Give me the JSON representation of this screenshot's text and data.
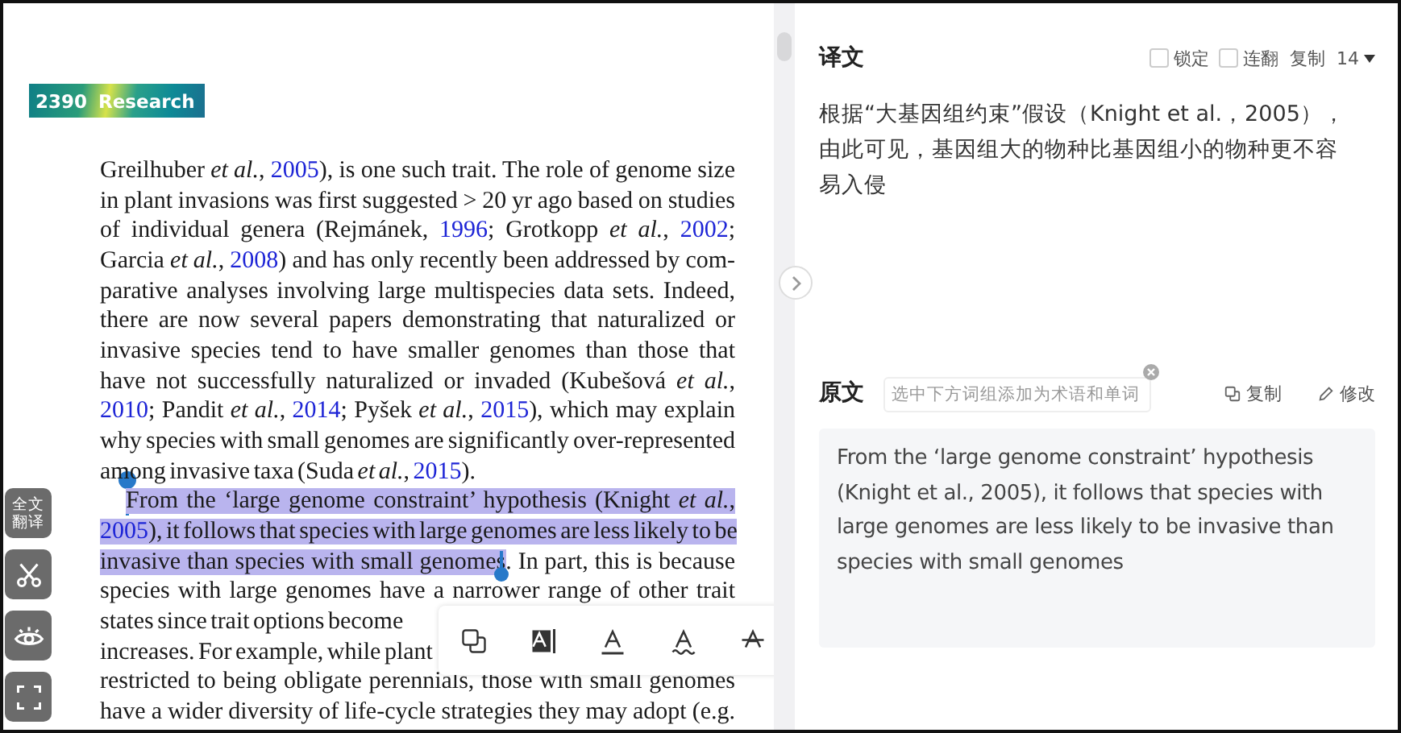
{
  "document": {
    "banner": {
      "number": "2390",
      "section": "Research"
    },
    "paragraphs": [
      {
        "indented": false,
        "lines": [
          {
            "justified": true,
            "segments": [
              {
                "kind": "text",
                "text": "Greilhuber ",
                "highlighted": false
              },
              {
                "kind": "italic",
                "text": "et al.",
                "highlighted": false
              },
              {
                "kind": "text",
                "text": ", ",
                "highlighted": false
              },
              {
                "kind": "link",
                "text": "2005",
                "highlighted": false
              },
              {
                "kind": "text",
                "text": "), is one such trait. The role of genome size",
                "highlighted": false
              }
            ]
          },
          {
            "justified": true,
            "segments": [
              {
                "kind": "text",
                "text": "in plant invasions was first suggested > 20 yr ago based on studies",
                "highlighted": false
              }
            ]
          },
          {
            "justified": true,
            "segments": [
              {
                "kind": "text",
                "text": "of individual genera (Rejmánek, ",
                "highlighted": false
              },
              {
                "kind": "link",
                "text": "1996",
                "highlighted": false
              },
              {
                "kind": "text",
                "text": "; Grotkopp ",
                "highlighted": false
              },
              {
                "kind": "italic",
                "text": "et al.",
                "highlighted": false
              },
              {
                "kind": "text",
                "text": ", ",
                "highlighted": false
              },
              {
                "kind": "link",
                "text": "2002",
                "highlighted": false
              },
              {
                "kind": "text",
                "text": ";",
                "highlighted": false
              }
            ]
          },
          {
            "justified": true,
            "segments": [
              {
                "kind": "text",
                "text": "Garcia ",
                "highlighted": false
              },
              {
                "kind": "italic",
                "text": "et al.",
                "highlighted": false
              },
              {
                "kind": "text",
                "text": ", ",
                "highlighted": false
              },
              {
                "kind": "link",
                "text": "2008",
                "highlighted": false
              },
              {
                "kind": "text",
                "text": ") and has only recently been addressed by com-",
                "highlighted": false
              }
            ]
          },
          {
            "justified": true,
            "segments": [
              {
                "kind": "text",
                "text": "parative analyses involving large multispecies data sets. Indeed,",
                "highlighted": false
              }
            ]
          },
          {
            "justified": true,
            "segments": [
              {
                "kind": "text",
                "text": "there are now several papers demonstrating that naturalized or",
                "highlighted": false
              }
            ]
          },
          {
            "justified": true,
            "segments": [
              {
                "kind": "text",
                "text": "invasive species tend to have smaller genomes than those that",
                "highlighted": false
              }
            ]
          },
          {
            "justified": true,
            "segments": [
              {
                "kind": "text",
                "text": "have not successfully naturalized or invaded (Kubešová ",
                "highlighted": false
              },
              {
                "kind": "italic",
                "text": "et al.",
                "highlighted": false
              },
              {
                "kind": "text",
                "text": ",",
                "highlighted": false
              }
            ]
          },
          {
            "justified": true,
            "segments": [
              {
                "kind": "link",
                "text": "2010",
                "highlighted": false
              },
              {
                "kind": "text",
                "text": "; Pandit ",
                "highlighted": false
              },
              {
                "kind": "italic",
                "text": "et al.",
                "highlighted": false
              },
              {
                "kind": "text",
                "text": ", ",
                "highlighted": false
              },
              {
                "kind": "link",
                "text": "2014",
                "highlighted": false
              },
              {
                "kind": "text",
                "text": "; Pyšek ",
                "highlighted": false
              },
              {
                "kind": "italic",
                "text": "et al.",
                "highlighted": false
              },
              {
                "kind": "text",
                "text": ", ",
                "highlighted": false
              },
              {
                "kind": "link",
                "text": "2015",
                "highlighted": false
              },
              {
                "kind": "text",
                "text": "), which may explain",
                "highlighted": false
              }
            ]
          },
          {
            "justified": true,
            "segments": [
              {
                "kind": "text",
                "text": "why species with small genomes are significantly over-represented",
                "highlighted": false
              }
            ]
          },
          {
            "justified": false,
            "segments": [
              {
                "kind": "text",
                "text": "among invasive taxa (Suda ",
                "highlighted": false
              },
              {
                "kind": "italic",
                "text": "et al.",
                "highlighted": false
              },
              {
                "kind": "text",
                "text": ", ",
                "highlighted": false
              },
              {
                "kind": "link",
                "text": "2015",
                "highlighted": false
              },
              {
                "kind": "text",
                "text": ").",
                "highlighted": false
              }
            ]
          }
        ]
      },
      {
        "indented": true,
        "lines": [
          {
            "justified": true,
            "segments": [
              {
                "kind": "text",
                "text": "From the ‘large genome constraint’ hypothesis (Knight ",
                "highlighted": true
              },
              {
                "kind": "italic",
                "text": "et al.",
                "highlighted": true
              },
              {
                "kind": "text",
                "text": ",",
                "highlighted": true
              }
            ]
          },
          {
            "justified": true,
            "segments": [
              {
                "kind": "link",
                "text": "2005",
                "highlighted": true
              },
              {
                "kind": "text",
                "text": "), it follows that species with large genomes are less likely to be",
                "highlighted": true
              }
            ]
          },
          {
            "justified": true,
            "segments": [
              {
                "kind": "text",
                "text": "invasive than species with small genomes",
                "highlighted": true
              },
              {
                "kind": "text",
                "text": ". In part, this is because",
                "highlighted": false
              }
            ]
          },
          {
            "justified": true,
            "segments": [
              {
                "kind": "text",
                "text": "species with large genomes have a narrower range of other trait",
                "highlighted": false
              }
            ]
          },
          {
            "justified": false,
            "segments": [
              {
                "kind": "text",
                "text": "states since trait options become",
                "highlighted": false
              }
            ]
          },
          {
            "justified": false,
            "segments": [
              {
                "kind": "text",
                "text": "increases. For example, while plant",
                "highlighted": false
              }
            ]
          },
          {
            "justified": true,
            "segments": [
              {
                "kind": "text",
                "text": "restricted to being obligate perennials, those with small genomes",
                "highlighted": false
              }
            ]
          },
          {
            "justified": true,
            "segments": [
              {
                "kind": "text",
                "text": "have a wider diversity of life-cycle strategies they may adopt (e.g.",
                "highlighted": false
              }
            ]
          }
        ]
      }
    ]
  },
  "side_tools": [
    {
      "kind": "text",
      "label": "全文翻译"
    },
    {
      "kind": "scissors"
    },
    {
      "kind": "eye"
    },
    {
      "kind": "frame"
    }
  ],
  "selection_toolbar": [
    {
      "kind": "copy"
    },
    {
      "kind": "highlight"
    },
    {
      "kind": "underline"
    },
    {
      "kind": "wavy"
    },
    {
      "kind": "strike"
    }
  ],
  "translation": {
    "title": "译文",
    "options": [
      {
        "label": "锁定",
        "checked": false
      },
      {
        "label": "连翻",
        "checked": false
      }
    ],
    "copy": "复制",
    "font_size": "14",
    "text": "根据“大基因组约束”假设（Knight et al.，2005），由此可见，基因组大的物种比基因组小的物种更不容易入侵"
  },
  "source": {
    "title": "原文",
    "placeholder": "选中下方词组添加为术语和单词",
    "copy": "复制",
    "edit": "修改",
    "text": "From the ‘large genome constraint’ hypothesis (Knight et al., 2005), it follows that species with large genomes are less likely to be invasive than species with small genomes"
  }
}
